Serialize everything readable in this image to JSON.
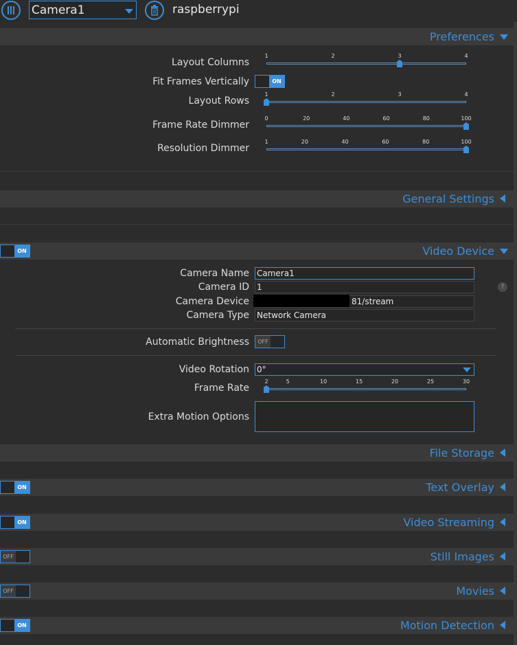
{
  "topbar": {
    "camera_select": "Camera1",
    "host": "raspberrypi"
  },
  "preferences": {
    "title": "Preferences",
    "layout_columns": {
      "label": "Layout Columns",
      "ticks": [
        "1",
        "2",
        "3",
        "4"
      ],
      "value": 3,
      "min": 1,
      "max": 4
    },
    "fit_frames": {
      "label": "Fit Frames Vertically",
      "state": "ON"
    },
    "layout_rows": {
      "label": "Layout Rows",
      "ticks": [
        "1",
        "2",
        "3",
        "4"
      ],
      "value": 1,
      "min": 1,
      "max": 4
    },
    "frame_rate_dimmer": {
      "label": "Frame Rate Dimmer",
      "ticks": [
        "0",
        "20",
        "40",
        "60",
        "80",
        "100"
      ],
      "value": 100,
      "min": 0,
      "max": 100
    },
    "resolution_dimmer": {
      "label": "Resolution Dimmer",
      "ticks": [
        "1",
        "20",
        "40",
        "60",
        "80",
        "100"
      ],
      "value": 100,
      "min": 1,
      "max": 100
    }
  },
  "general_settings": {
    "title": "General Settings"
  },
  "video_device": {
    "title": "Video Device",
    "toggle": "ON",
    "camera_name": {
      "label": "Camera Name",
      "value": "Camera1"
    },
    "camera_id": {
      "label": "Camera ID",
      "value": "1"
    },
    "camera_device": {
      "label": "Camera Device",
      "value": "81/stream"
    },
    "camera_type": {
      "label": "Camera Type",
      "value": "Network Camera"
    },
    "help": "?",
    "auto_brightness": {
      "label": "Automatic Brightness",
      "state": "OFF"
    },
    "video_rotation": {
      "label": "Video Rotation",
      "value": "0°"
    },
    "frame_rate": {
      "label": "Frame Rate",
      "ticks": [
        "2",
        "5",
        "10",
        "15",
        "20",
        "25",
        "30"
      ],
      "value": 2,
      "min": 2,
      "max": 30
    },
    "extra_motion": {
      "label": "Extra Motion Options",
      "value": ""
    }
  },
  "sections": [
    {
      "title": "File Storage",
      "toggle": null
    },
    {
      "title": "Text Overlay",
      "toggle": "ON"
    },
    {
      "title": "Video Streaming",
      "toggle": "ON"
    },
    {
      "title": "Still Images",
      "toggle": "OFF"
    },
    {
      "title": "Movies",
      "toggle": "OFF"
    },
    {
      "title": "Motion Detection",
      "toggle": "ON"
    }
  ],
  "colors": {
    "accent": "#3d8ed6",
    "background": "#2c2c2c",
    "bar": "#3a3a3a"
  }
}
